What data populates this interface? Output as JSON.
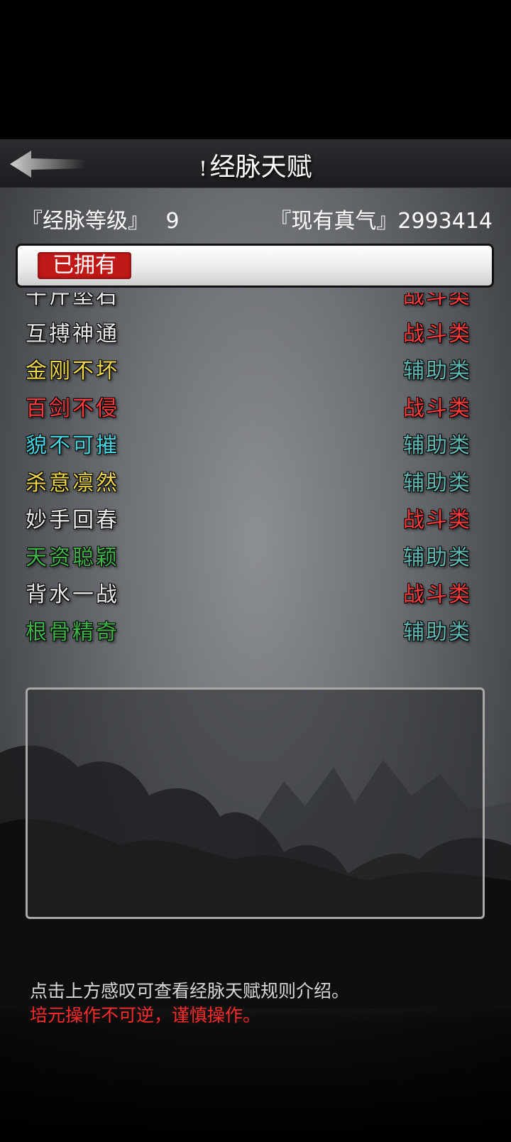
{
  "header": {
    "info_mark": "!",
    "title": "经脉天赋"
  },
  "stats": {
    "level_label": "『经脉等级』",
    "level_value": "9",
    "qi_label": "『现有真气』",
    "qi_value": "2993414"
  },
  "tab": {
    "owned_label": "已拥有"
  },
  "talents": [
    {
      "name": "千斤坠石",
      "type": "战斗类",
      "name_color": "#e8e8e8",
      "type_color": "#ff3b3b"
    },
    {
      "name": "互搏神通",
      "type": "战斗类",
      "name_color": "#e8e8e8",
      "type_color": "#ff3b3b"
    },
    {
      "name": "金刚不坏",
      "type": "辅助类",
      "name_color": "#f0d84a",
      "type_color": "#5fb8b2"
    },
    {
      "name": "百剑不侵",
      "type": "战斗类",
      "name_color": "#ff3b3b",
      "type_color": "#ff3b3b"
    },
    {
      "name": "貌不可摧",
      "type": "辅助类",
      "name_color": "#43d4df",
      "type_color": "#5fb8b2"
    },
    {
      "name": "杀意凛然",
      "type": "辅助类",
      "name_color": "#f0d84a",
      "type_color": "#5fb8b2"
    },
    {
      "name": "妙手回春",
      "type": "战斗类",
      "name_color": "#e8e8e8",
      "type_color": "#ff3b3b"
    },
    {
      "name": "天资聪颖",
      "type": "辅助类",
      "name_color": "#3fb548",
      "type_color": "#5fb8b2"
    },
    {
      "name": "背水一战",
      "type": "战斗类",
      "name_color": "#e8e8e8",
      "type_color": "#ff3b3b"
    },
    {
      "name": "根骨精奇",
      "type": "辅助类",
      "name_color": "#3fb548",
      "type_color": "#5fb8b2"
    }
  ],
  "footer": {
    "hint": "点击上方感叹可查看经脉天赋规则介绍。",
    "warning": "培元操作不可逆，谨慎操作。"
  },
  "colors": {
    "tab_red": "#c11818",
    "combat_red": "#ff3b3b",
    "support_teal": "#5fb8b2",
    "warning_red": "#ff2a2a"
  }
}
